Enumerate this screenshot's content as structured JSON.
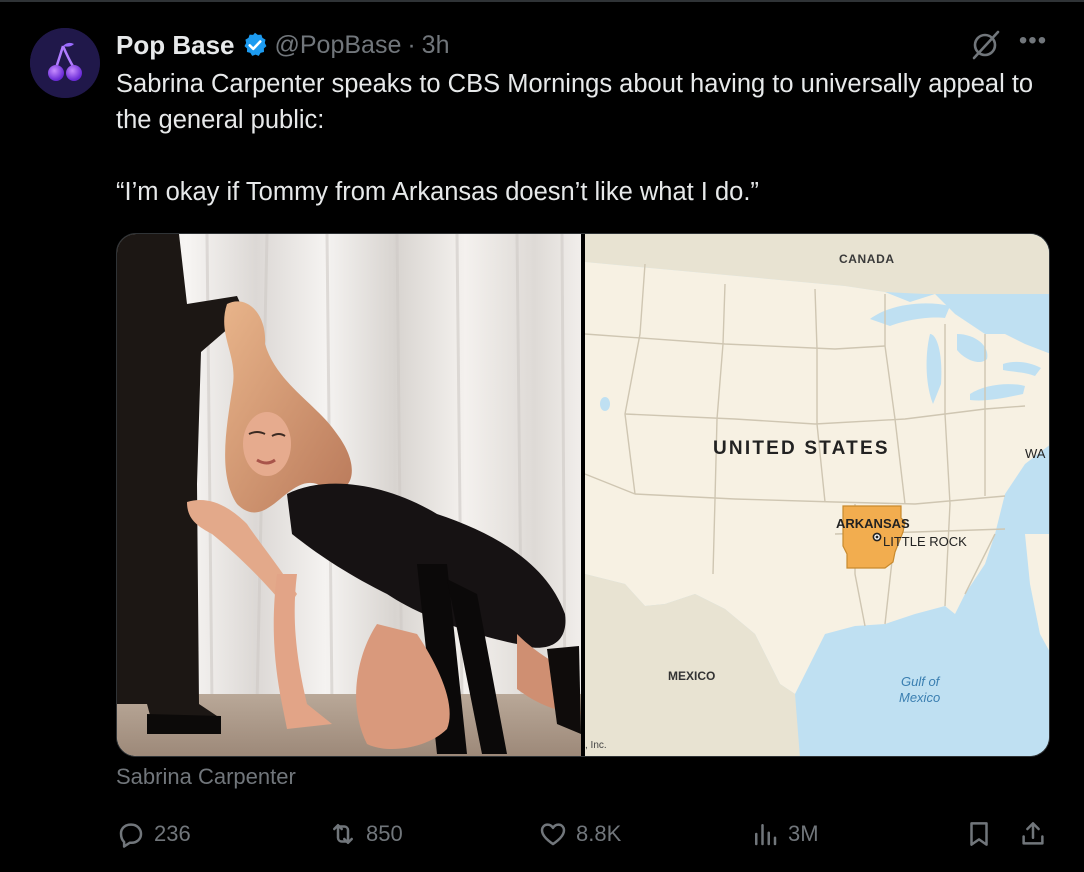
{
  "author": {
    "name": "Pop Base",
    "handle": "@PopBase",
    "separator": "·",
    "time": "3h"
  },
  "tweet": {
    "line1": "Sabrina Carpenter speaks to CBS Mornings about having to universally appeal to the general public:",
    "line2": "“I’m okay if Tommy from Arkansas doesn’t like what I do.”"
  },
  "map": {
    "canada": "CANADA",
    "country": "UNITED STATES",
    "state": "ARKANSAS",
    "capital": "LITTLE ROCK",
    "mexico": "MEXICO",
    "gulf_line1": "Gulf of",
    "gulf_line2": "Mexico",
    "edge_label": "WA",
    "credit": ", Inc."
  },
  "media_caption": "Sabrina Carpenter",
  "stats": {
    "replies": "236",
    "reposts": "850",
    "likes": "8.8K",
    "views": "3M"
  },
  "colors": {
    "background": "#000000",
    "text": "#e7e9ea",
    "muted": "#71767b",
    "verified": "#1d9bf0",
    "arkansas": "#f2ad4f",
    "land": "#f7f1e3"
  }
}
